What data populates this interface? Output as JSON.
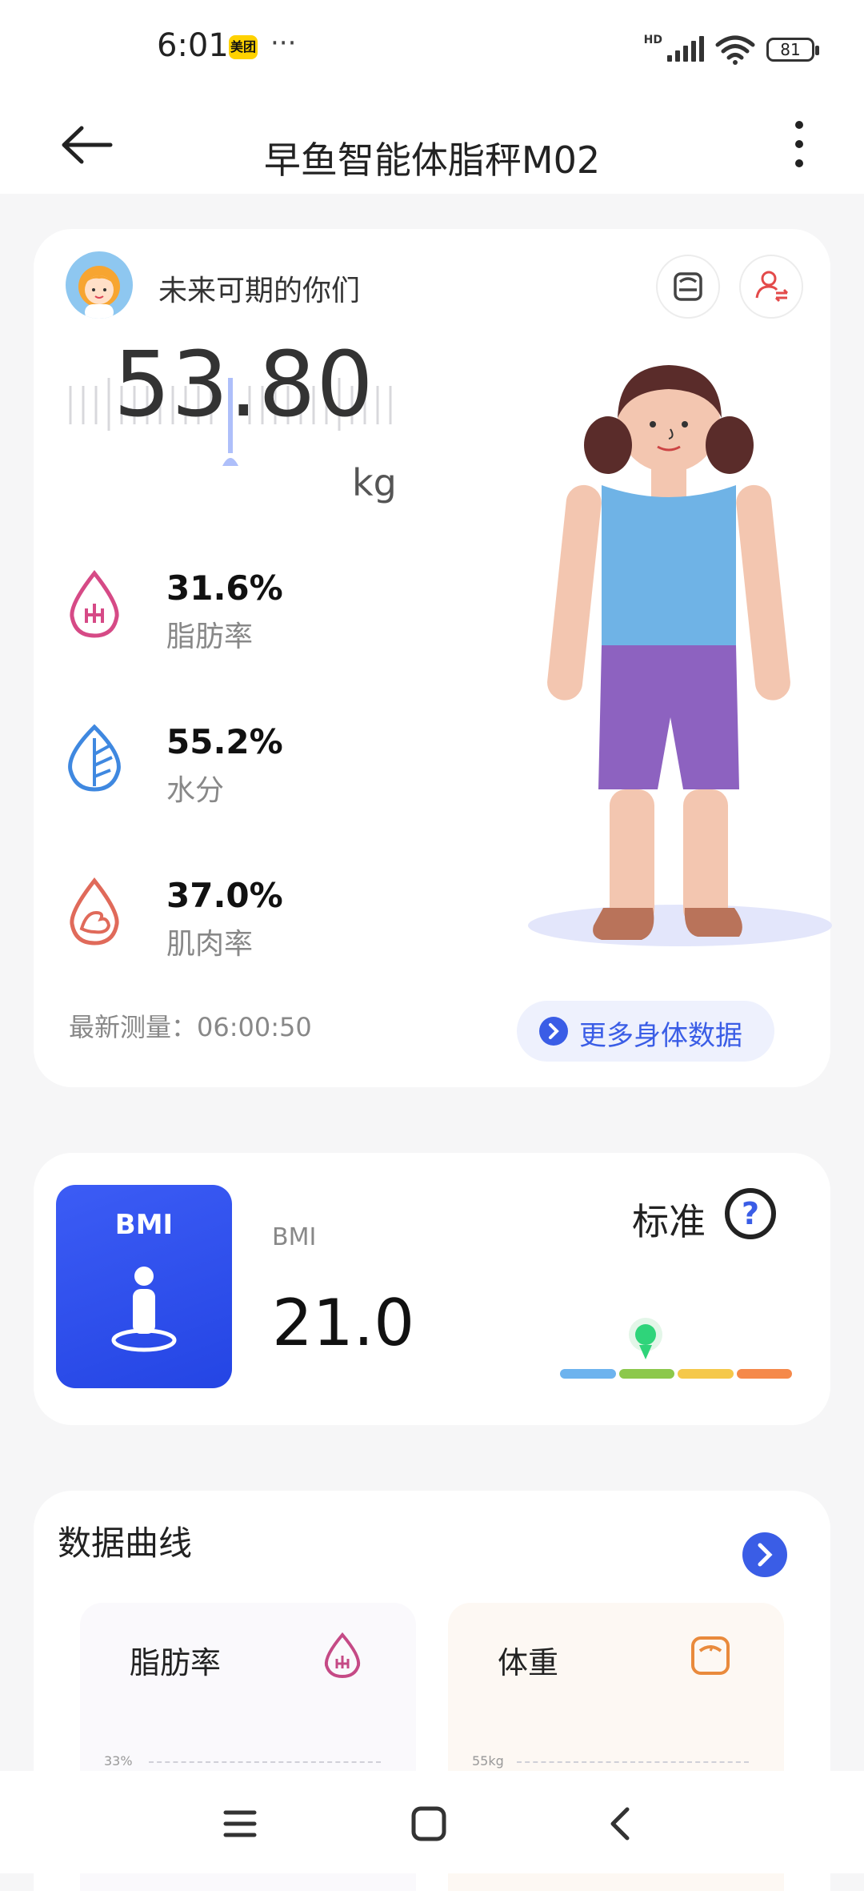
{
  "status_bar": {
    "time": "6:01",
    "app_badge": "美团",
    "more": "···",
    "network": "HD",
    "battery": "81"
  },
  "app_bar": {
    "title": "早鱼智能体脂秤M02"
  },
  "profile": {
    "username": "未来可期的你们"
  },
  "weight": {
    "value": "53.80",
    "unit": "kg"
  },
  "metrics": [
    {
      "value": "31.6%",
      "label": "脂肪率",
      "icon": "fat-drop-icon",
      "color": "#d64a86"
    },
    {
      "value": "55.2%",
      "label": "水分",
      "icon": "water-leaf-icon",
      "color": "#3f88e0"
    },
    {
      "value": "37.0%",
      "label": "肌肉率",
      "icon": "muscle-drop-icon",
      "color": "#e06a5a"
    }
  ],
  "latest_measurement": "最新测量：06:00:50",
  "more_data_label": "更多身体数据",
  "bmi": {
    "tile_label": "BMI",
    "label": "BMI",
    "value": "21.0",
    "status": "标准",
    "help": "?",
    "scale_colors": [
      "#6db3ee",
      "#8cc84b",
      "#f5c84a",
      "#f5894a"
    ],
    "level": 0.37
  },
  "curves": {
    "title": "数据曲线",
    "cards": [
      {
        "title": "脂肪率",
        "tick": "33%"
      },
      {
        "title": "体重",
        "tick": "55kg"
      }
    ]
  },
  "colors": {
    "accent": "#3a5de6"
  }
}
